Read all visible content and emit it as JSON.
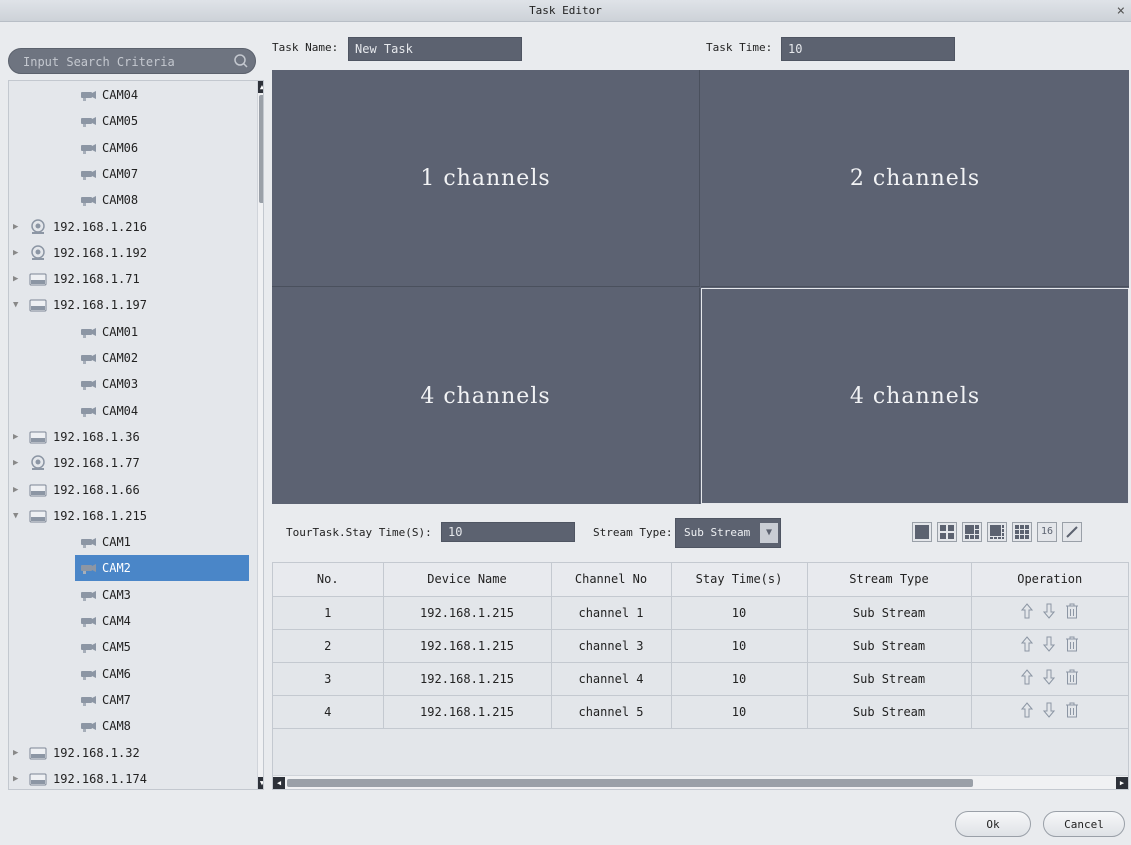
{
  "window": {
    "title": "Task Editor",
    "close_glyph": "×"
  },
  "search": {
    "placeholder": "Input Search Criteria"
  },
  "tree": [
    {
      "label": "CAM04",
      "type": "camera",
      "level": 1
    },
    {
      "label": "CAM05",
      "type": "camera",
      "level": 1
    },
    {
      "label": "CAM06",
      "type": "camera",
      "level": 1
    },
    {
      "label": "CAM07",
      "type": "camera",
      "level": 1
    },
    {
      "label": "CAM08",
      "type": "camera",
      "level": 1
    },
    {
      "label": "192.168.1.216",
      "type": "ipc",
      "level": 0,
      "expanded": false
    },
    {
      "label": "192.168.1.192",
      "type": "ipc",
      "level": 0,
      "expanded": false
    },
    {
      "label": "192.168.1.71",
      "type": "nvr",
      "level": 0,
      "expanded": false
    },
    {
      "label": "192.168.1.197",
      "type": "nvr",
      "level": 0,
      "expanded": true
    },
    {
      "label": "CAM01",
      "type": "camera",
      "level": 1
    },
    {
      "label": "CAM02",
      "type": "camera",
      "level": 1
    },
    {
      "label": "CAM03",
      "type": "camera",
      "level": 1
    },
    {
      "label": "CAM04",
      "type": "camera",
      "level": 1
    },
    {
      "label": "192.168.1.36",
      "type": "nvr",
      "level": 0,
      "expanded": false
    },
    {
      "label": "192.168.1.77",
      "type": "ipc",
      "level": 0,
      "expanded": false
    },
    {
      "label": "192.168.1.66",
      "type": "nvr",
      "level": 0,
      "expanded": false
    },
    {
      "label": "192.168.1.215",
      "type": "nvr",
      "level": 0,
      "expanded": true
    },
    {
      "label": "CAM1",
      "type": "camera",
      "level": 1
    },
    {
      "label": "CAM2",
      "type": "camera",
      "level": 1,
      "selected": true
    },
    {
      "label": "CAM3",
      "type": "camera",
      "level": 1
    },
    {
      "label": "CAM4",
      "type": "camera",
      "level": 1
    },
    {
      "label": "CAM5",
      "type": "camera",
      "level": 1
    },
    {
      "label": "CAM6",
      "type": "camera",
      "level": 1
    },
    {
      "label": "CAM7",
      "type": "camera",
      "level": 1
    },
    {
      "label": "CAM8",
      "type": "camera",
      "level": 1
    },
    {
      "label": "192.168.1.32",
      "type": "nvr",
      "level": 0,
      "expanded": false
    },
    {
      "label": "192.168.1.174",
      "type": "nvr",
      "level": 0,
      "expanded": false
    }
  ],
  "task": {
    "name_label": "Task Name:",
    "name_value": "New Task",
    "time_label": "Task Time:",
    "time_value": "10"
  },
  "grid": [
    {
      "label": "1 channels"
    },
    {
      "label": "2 channels"
    },
    {
      "label": "4 channels"
    },
    {
      "label": "4 channels"
    }
  ],
  "controls": {
    "stay_label": "TourTask.Stay Time(S):",
    "stay_value": "10",
    "stream_label": "Stream Type:",
    "stream_value": "Sub Stream",
    "layout_16_label": "16"
  },
  "table": {
    "headers": [
      "No.",
      "Device Name",
      "Channel No",
      "Stay Time(s)",
      "Stream Type",
      "Operation"
    ],
    "rows": [
      [
        "1",
        "192.168.1.215",
        "channel 1",
        "10",
        "Sub Stream"
      ],
      [
        "2",
        "192.168.1.215",
        "channel 3",
        "10",
        "Sub Stream"
      ],
      [
        "3",
        "192.168.1.215",
        "channel 4",
        "10",
        "Sub Stream"
      ],
      [
        "4",
        "192.168.1.215",
        "channel 5",
        "10",
        "Sub Stream"
      ]
    ]
  },
  "buttons": {
    "ok": "Ok",
    "cancel": "Cancel"
  },
  "colors": {
    "accent": "#4a86c8",
    "panel": "#5c6272"
  }
}
